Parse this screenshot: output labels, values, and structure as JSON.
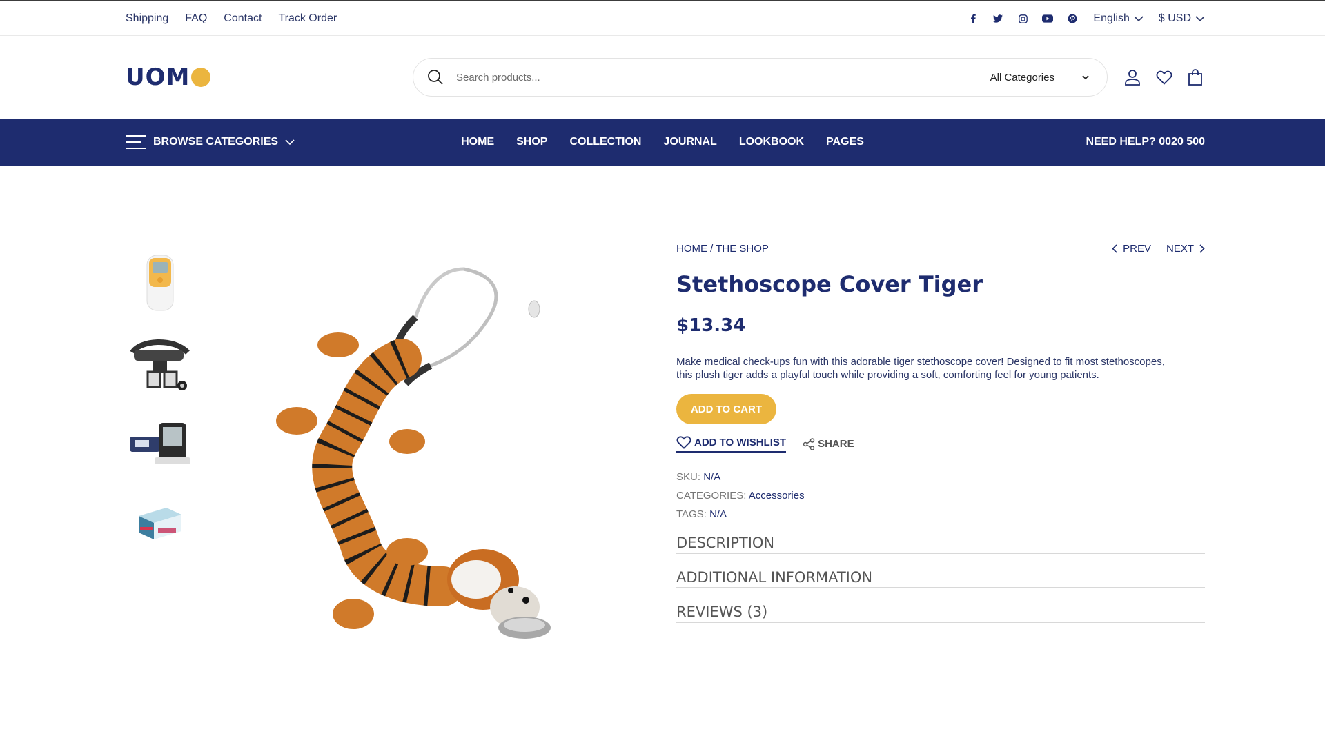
{
  "topbar": {
    "links": [
      "Shipping",
      "FAQ",
      "Contact",
      "Track Order"
    ],
    "social_icons": [
      "facebook-icon",
      "twitter-icon",
      "instagram-icon",
      "youtube-icon",
      "pinterest-icon"
    ],
    "language": "English",
    "currency": "$ USD"
  },
  "header": {
    "logo_text": "UOM",
    "search_placeholder": "Search products...",
    "category_select": "All Categories",
    "icons": [
      "user-icon",
      "heart-icon",
      "cart-bag-icon"
    ]
  },
  "nav": {
    "browse": "BROWSE CATEGORIES",
    "menu": [
      "HOME",
      "SHOP",
      "COLLECTION",
      "JOURNAL",
      "LOOKBOOK",
      "PAGES"
    ],
    "help": "NEED HELP? 0020 500"
  },
  "product": {
    "breadcrumb": "HOME / THE SHOP",
    "prev": "PREV",
    "next": "NEXT",
    "title": "Stethoscope Cover Tiger",
    "price": "$13.34",
    "description": "Make medical check-ups fun with this adorable tiger stethoscope cover! Designed to fit most stethoscopes, this plush tiger adds a playful touch while providing a soft, comforting feel for young patients.",
    "add_to_cart": "ADD TO CART",
    "add_to_wishlist": "ADD TO WISHLIST",
    "share": "SHARE",
    "meta": {
      "sku_label": "SKU:",
      "sku": "N/A",
      "categories_label": "CATEGORIES:",
      "categories": "Accessories",
      "tags_label": "TAGS:",
      "tags": "N/A"
    },
    "tabs": [
      "DESCRIPTION",
      "ADDITIONAL INFORMATION",
      "REVIEWS (3)"
    ]
  },
  "colors": {
    "brand_navy": "#1e2c6f",
    "accent_yellow": "#ebb53f"
  }
}
